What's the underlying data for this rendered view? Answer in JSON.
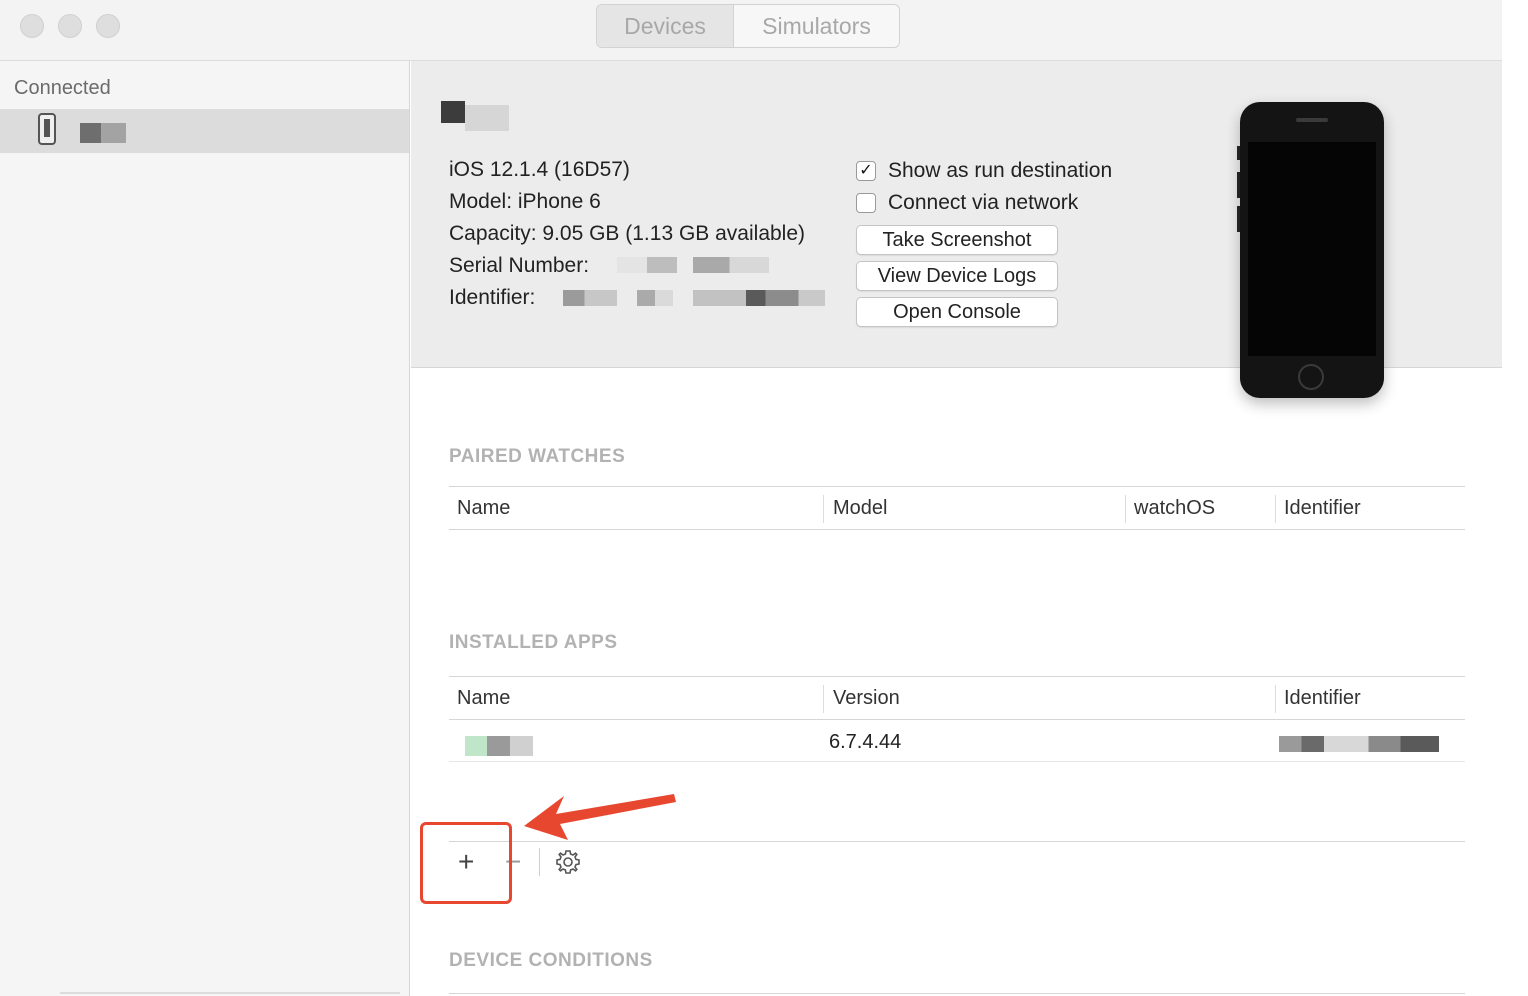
{
  "window": {
    "tabs": [
      {
        "label": "Devices",
        "selected": true
      },
      {
        "label": "Simulators",
        "selected": false
      }
    ]
  },
  "sidebar": {
    "heading": "Connected"
  },
  "device": {
    "os_line": "iOS 12.1.4 (16D57)",
    "model_line": "Model: iPhone 6",
    "capacity_line": "Capacity: 9.05 GB (1.13 GB available)",
    "serial_label": "Serial Number:",
    "identifier_label": "Identifier:",
    "options": [
      {
        "label": "Show as run destination",
        "checked": true
      },
      {
        "label": "Connect via network",
        "checked": false
      }
    ],
    "buttons": {
      "screenshot": "Take Screenshot",
      "logs": "View Device Logs",
      "console": "Open Console"
    },
    "check_glyph": "✓"
  },
  "paired_watches": {
    "title": "PAIRED WATCHES",
    "columns": [
      "Name",
      "Model",
      "watchOS",
      "Identifier"
    ]
  },
  "installed_apps": {
    "title": "INSTALLED APPS",
    "columns": [
      "Name",
      "Version",
      "Identifier"
    ],
    "rows": [
      {
        "version": "6.7.4.44"
      }
    ]
  },
  "app_toolbar": {
    "add_glyph": "+",
    "remove_glyph": "−",
    "settings_icon": "gear-icon"
  },
  "device_conditions": {
    "title": "DEVICE CONDITIONS"
  },
  "annotation": {
    "color": "#e8472f"
  }
}
